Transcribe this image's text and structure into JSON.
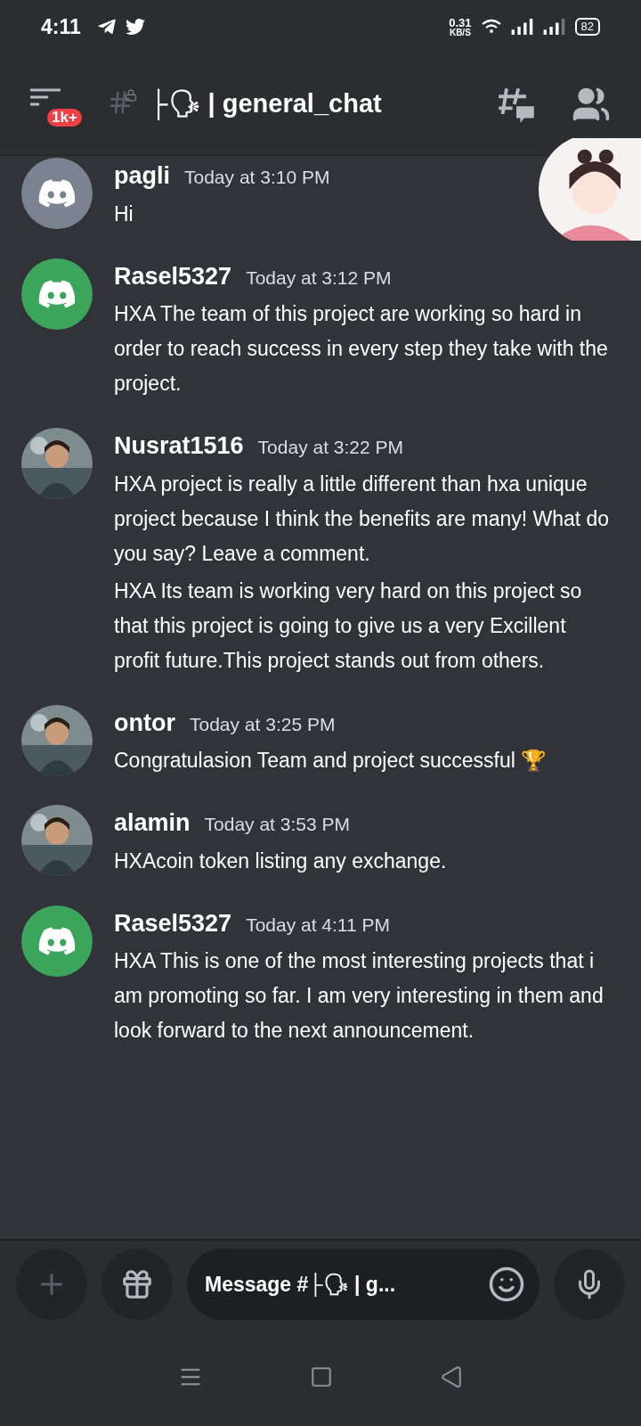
{
  "status_bar": {
    "time": "4:11",
    "speed_value": "0.31",
    "speed_unit": "KB/S",
    "battery": "82"
  },
  "header": {
    "badge": "1k+",
    "channel": "├🗣 | general_chat"
  },
  "messages": [
    {
      "author": "pagli",
      "time": "Today at 3:10 PM",
      "avatar": {
        "kind": "discord",
        "color": "#7b8391"
      },
      "paragraphs": [
        "Hi"
      ]
    },
    {
      "author": "Rasel5327",
      "time": "Today at 3:12 PM",
      "avatar": {
        "kind": "discord",
        "color": "#3ba55c"
      },
      "paragraphs": [
        "HXA The team of this project are working so hard in order to reach success in every step they take with the project."
      ]
    },
    {
      "author": "Nusrat1516",
      "time": "Today at 3:22 PM",
      "avatar": {
        "kind": "picture"
      },
      "paragraphs": [
        "HXA project is really a little different than hxa unique project because I think the benefits are many! What do you say? Leave a comment.",
        "HXA Its team is working very hard on this project so that this project is going to give us a very Excillent profit future.This project stands out from others."
      ]
    },
    {
      "author": "ontor",
      "time": "Today at 3:25 PM",
      "avatar": {
        "kind": "picture"
      },
      "paragraphs": [
        "Congratulasion Team and project successful 🏆"
      ]
    },
    {
      "author": "alamin",
      "time": "Today at 3:53 PM",
      "avatar": {
        "kind": "picture"
      },
      "paragraphs": [
        "HXAcoin token listing any exchange."
      ]
    },
    {
      "author": "Rasel5327",
      "time": "Today at 4:11 PM",
      "avatar": {
        "kind": "discord",
        "color": "#3ba55c"
      },
      "paragraphs": [
        "HXA This is one of the most interesting projects that i am promoting so far. I am very interesting in them and look forward to the next announcement."
      ]
    }
  ],
  "composer": {
    "placeholder": "Message #├🗣 | g..."
  }
}
